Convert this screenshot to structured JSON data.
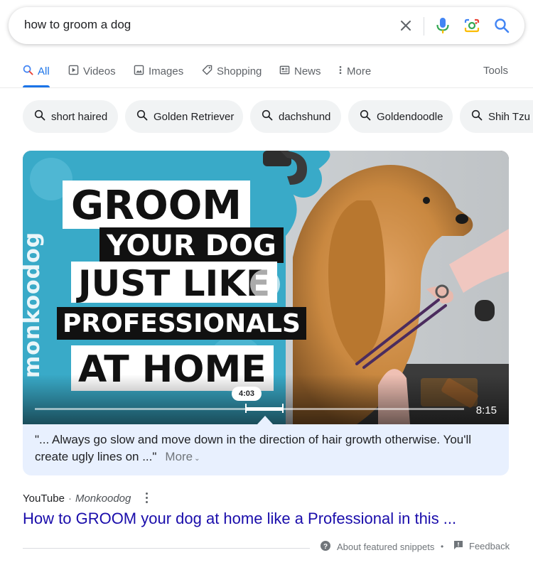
{
  "search": {
    "query": "how to groom a dog"
  },
  "tabs": [
    {
      "label": "All",
      "icon": "search-icon",
      "active": true
    },
    {
      "label": "Videos",
      "icon": "play-icon"
    },
    {
      "label": "Images",
      "icon": "image-icon"
    },
    {
      "label": "Shopping",
      "icon": "tag-icon"
    },
    {
      "label": "News",
      "icon": "news-icon"
    },
    {
      "label": "More",
      "icon": "more-vert-icon"
    }
  ],
  "tools_label": "Tools",
  "chips": [
    {
      "label": "short haired"
    },
    {
      "label": "Golden Retriever"
    },
    {
      "label": "dachshund"
    },
    {
      "label": "Goldendoodle"
    },
    {
      "label": "Shih Tzu"
    }
  ],
  "video": {
    "watermark": "monkoodog",
    "title_lines": [
      "GROOM",
      "YOUR DOG",
      "JUST LIKE",
      "PROFESSIONALS",
      "AT HOME"
    ],
    "timestamp": "4:03",
    "duration": "8:15",
    "snippet": "\"... Always go slow and move down in the direction of hair growth otherwise. You'll create ugly lines on ...\"",
    "more_label": "More"
  },
  "result": {
    "site": "YouTube",
    "channel": "Monkoodog",
    "title": "How to GROOM your dog at home like a Professional in this ..."
  },
  "footer": {
    "about": "About featured snippets",
    "feedback": "Feedback"
  },
  "colors": {
    "link": "#1a0dab",
    "active_tab": "#1a73e8",
    "snippet_bg": "#e8f0fe"
  }
}
